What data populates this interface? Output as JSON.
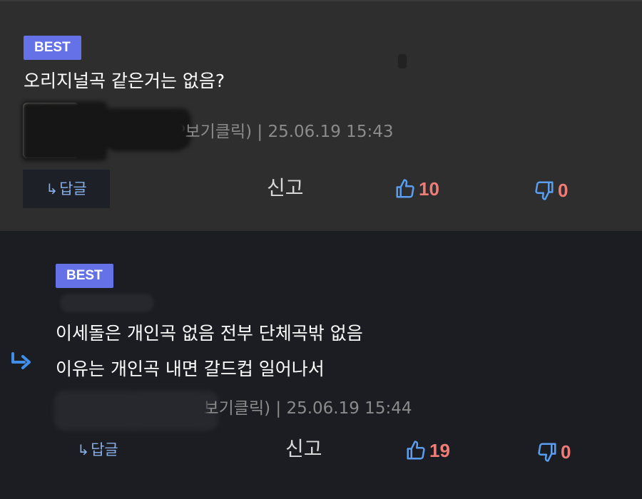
{
  "comments": [
    {
      "badge": "BEST",
      "text_lines": [
        "오리지널곡 같은거는 없음?"
      ],
      "meta_visible": "·! (IP보기클릭) | 25.06.19 15:43",
      "reply_label": "답글",
      "report_label": "신고",
      "upvotes": "10",
      "downvotes": "0"
    },
    {
      "badge": "BEST",
      "text_lines": [
        "이세돌은 개인곡 없음 전부 단체곡밖 없음",
        "이유는 개인곡 내면 갈드컵 일어나서"
      ],
      "meta_visible": "·! (IP보기클릭) | 25.06.19 15:44",
      "reply_label": "답글",
      "report_label": "신고",
      "upvotes": "19",
      "downvotes": "0"
    }
  ],
  "icons": {
    "reply_arrow": "reply-arrow-icon",
    "thumbs_up": "thumbs-up-icon",
    "thumbs_down": "thumbs-down-icon",
    "nested_reply": "nested-reply-icon"
  },
  "colors": {
    "badge": "#6571e6",
    "vote_count": "#f07c76",
    "icon_blue": "#5b9ef0",
    "reply_text": "#86aee6"
  }
}
